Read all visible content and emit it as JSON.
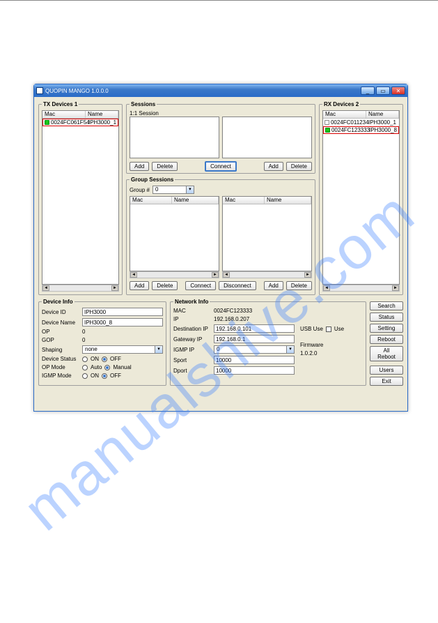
{
  "watermark": "manualshive.com",
  "window_title": "QUOPIN MANGO 1.0.0.0",
  "tx": {
    "legend": "TX Devices 1",
    "cols": {
      "mac": "Mac",
      "name": "Name"
    },
    "rows": [
      {
        "mac": "0024FC061F54",
        "name": "IPH3000_1"
      }
    ]
  },
  "rx": {
    "legend": "RX Devices 2",
    "cols": {
      "mac": "Mac",
      "name": "Name"
    },
    "rows": [
      {
        "mac": "0024FC011234",
        "name": "IPH3000_1"
      },
      {
        "mac": "0024FC123333",
        "name": "IPH3000_8"
      }
    ]
  },
  "sessions": {
    "legend": "Sessions",
    "sub": "1:1 Session",
    "add": "Add",
    "delete": "Delete",
    "connect": "Connect"
  },
  "group": {
    "legend": "Group Sessions",
    "label": "Group #",
    "value": "0",
    "cols": {
      "mac": "Mac",
      "name": "Name"
    },
    "add": "Add",
    "delete": "Delete",
    "connect": "Connect",
    "disconnect": "Disconnect"
  },
  "device_info": {
    "legend": "Device Info",
    "device_id": {
      "label": "Device ID",
      "value": "IPH3000"
    },
    "device_name": {
      "label": "Device Name",
      "value": "IPH3000_8"
    },
    "op": {
      "label": "OP",
      "value": "0"
    },
    "gop": {
      "label": "GOP",
      "value": "0"
    },
    "shaping": {
      "label": "Shaping",
      "value": "none"
    },
    "device_status": {
      "label": "Device Status",
      "on": "ON",
      "off": "OFF"
    },
    "op_mode": {
      "label": "OP Mode",
      "auto": "Auto",
      "manual": "Manual"
    },
    "igmp_mode": {
      "label": "IGMP Mode",
      "on": "ON",
      "off": "OFF"
    }
  },
  "network_info": {
    "legend": "Network Info",
    "mac": {
      "label": "MAC",
      "value": "0024FC123333"
    },
    "ip": {
      "label": "IP",
      "value": "192.168.0.207"
    },
    "dest_ip": {
      "label": "Destination IP",
      "value": "192.168.0.101"
    },
    "gateway": {
      "label": "Gateway IP",
      "value": "192.168.0.1"
    },
    "igmp_ip": {
      "label": "IGMP IP",
      "value": "0"
    },
    "sport": {
      "label": "Sport",
      "value": "10000"
    },
    "dport": {
      "label": "Dport",
      "value": "10000"
    },
    "usb": {
      "label": "USB Use",
      "use": "Use"
    },
    "firmware": {
      "label": "Firmware",
      "value": "1.0.2.0"
    }
  },
  "side": {
    "search": "Search",
    "status": "Status",
    "setting": "Setting",
    "reboot": "Reboot",
    "all_reboot": "All Reboot",
    "users": "Users",
    "exit": "Exit"
  }
}
